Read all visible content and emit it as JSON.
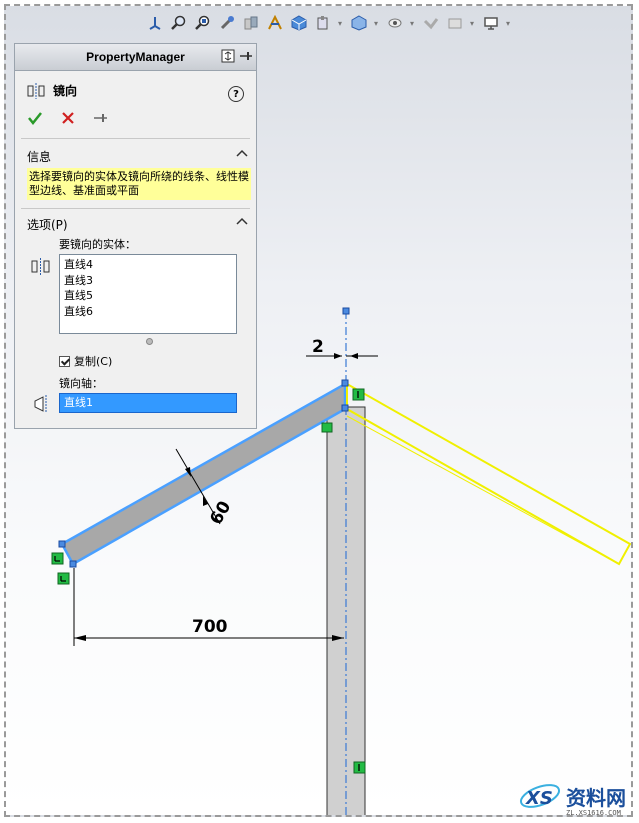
{
  "property_manager": {
    "title": "PropertyManager",
    "feature_name": "镜向",
    "help_label": "?",
    "info": {
      "header": "信息",
      "text": "选择要镜向的实体及镜向所绕的线条、线性模型边线、基准面或平面"
    },
    "options": {
      "header": "选项(P)",
      "entities_label": "要镜向的实体：",
      "entities": [
        "直线4",
        "直线3",
        "直线5",
        "直线6"
      ],
      "copy_label": "复制(C)",
      "copy_checked": true,
      "axis_label": "镜向轴：",
      "axis_value": "直线1"
    }
  },
  "sketch": {
    "dim_top": "2",
    "dim_width": "60",
    "dim_horizontal": "700"
  },
  "watermark": {
    "text": "资料网",
    "url": "ZL.XS1616.COM"
  },
  "colors": {
    "highlight_blue": "#3399ff",
    "preview_yellow": "#ffff00",
    "relation_green": "#22bb44"
  },
  "icons": [
    "view-orient-icon",
    "zoom-fit-icon",
    "zoom-area-icon",
    "previous-view-icon",
    "section-view-icon",
    "view-settings-icon",
    "display-style-icon",
    "hide-show-icon",
    "edit-appearance-icon",
    "apply-scene-icon",
    "view-setting-icon",
    "display-manager-icon"
  ]
}
